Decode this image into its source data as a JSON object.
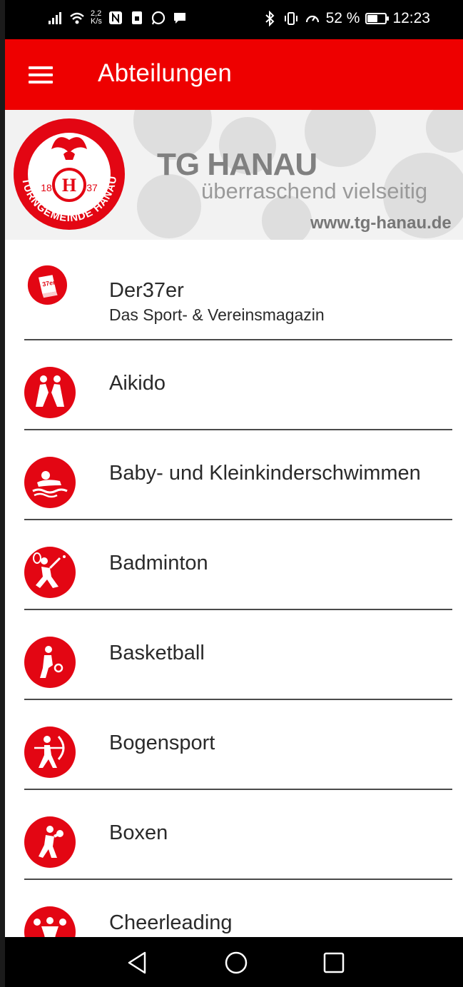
{
  "status_bar": {
    "net_speed_value": "2,2",
    "net_speed_unit": "K/s",
    "battery_percent": "52 %",
    "battery_level": 0.52,
    "time": "12:23"
  },
  "app_bar": {
    "title": "Abteilungen",
    "menu_icon": "hamburger-menu-icon"
  },
  "banner": {
    "title": "TG HANAU",
    "subtitle": "überraschend vielseitig",
    "url": "www.tg-hanau.de",
    "logo_text": "TURNGEMEINDE HANAU A.V.",
    "logo_year_left": "18",
    "logo_year_right": "37"
  },
  "departments": [
    {
      "label": "Der37er",
      "sublabel": "Das Sport- & Vereinsmagazin",
      "icon": "magazine-icon"
    },
    {
      "label": "Aikido",
      "icon": "aikido-icon"
    },
    {
      "label": "Baby- und Kleinkinderschwimmen",
      "icon": "baby-swimming-icon"
    },
    {
      "label": "Badminton",
      "icon": "badminton-icon"
    },
    {
      "label": "Basketball",
      "icon": "basketball-icon"
    },
    {
      "label": "Bogensport",
      "icon": "archery-icon"
    },
    {
      "label": "Boxen",
      "icon": "boxing-icon"
    },
    {
      "label": "Cheerleading",
      "icon": "cheerleading-icon"
    }
  ],
  "colors": {
    "accent": "#ee0000",
    "icon_red": "#e30613",
    "text": "#2a2a2a"
  }
}
